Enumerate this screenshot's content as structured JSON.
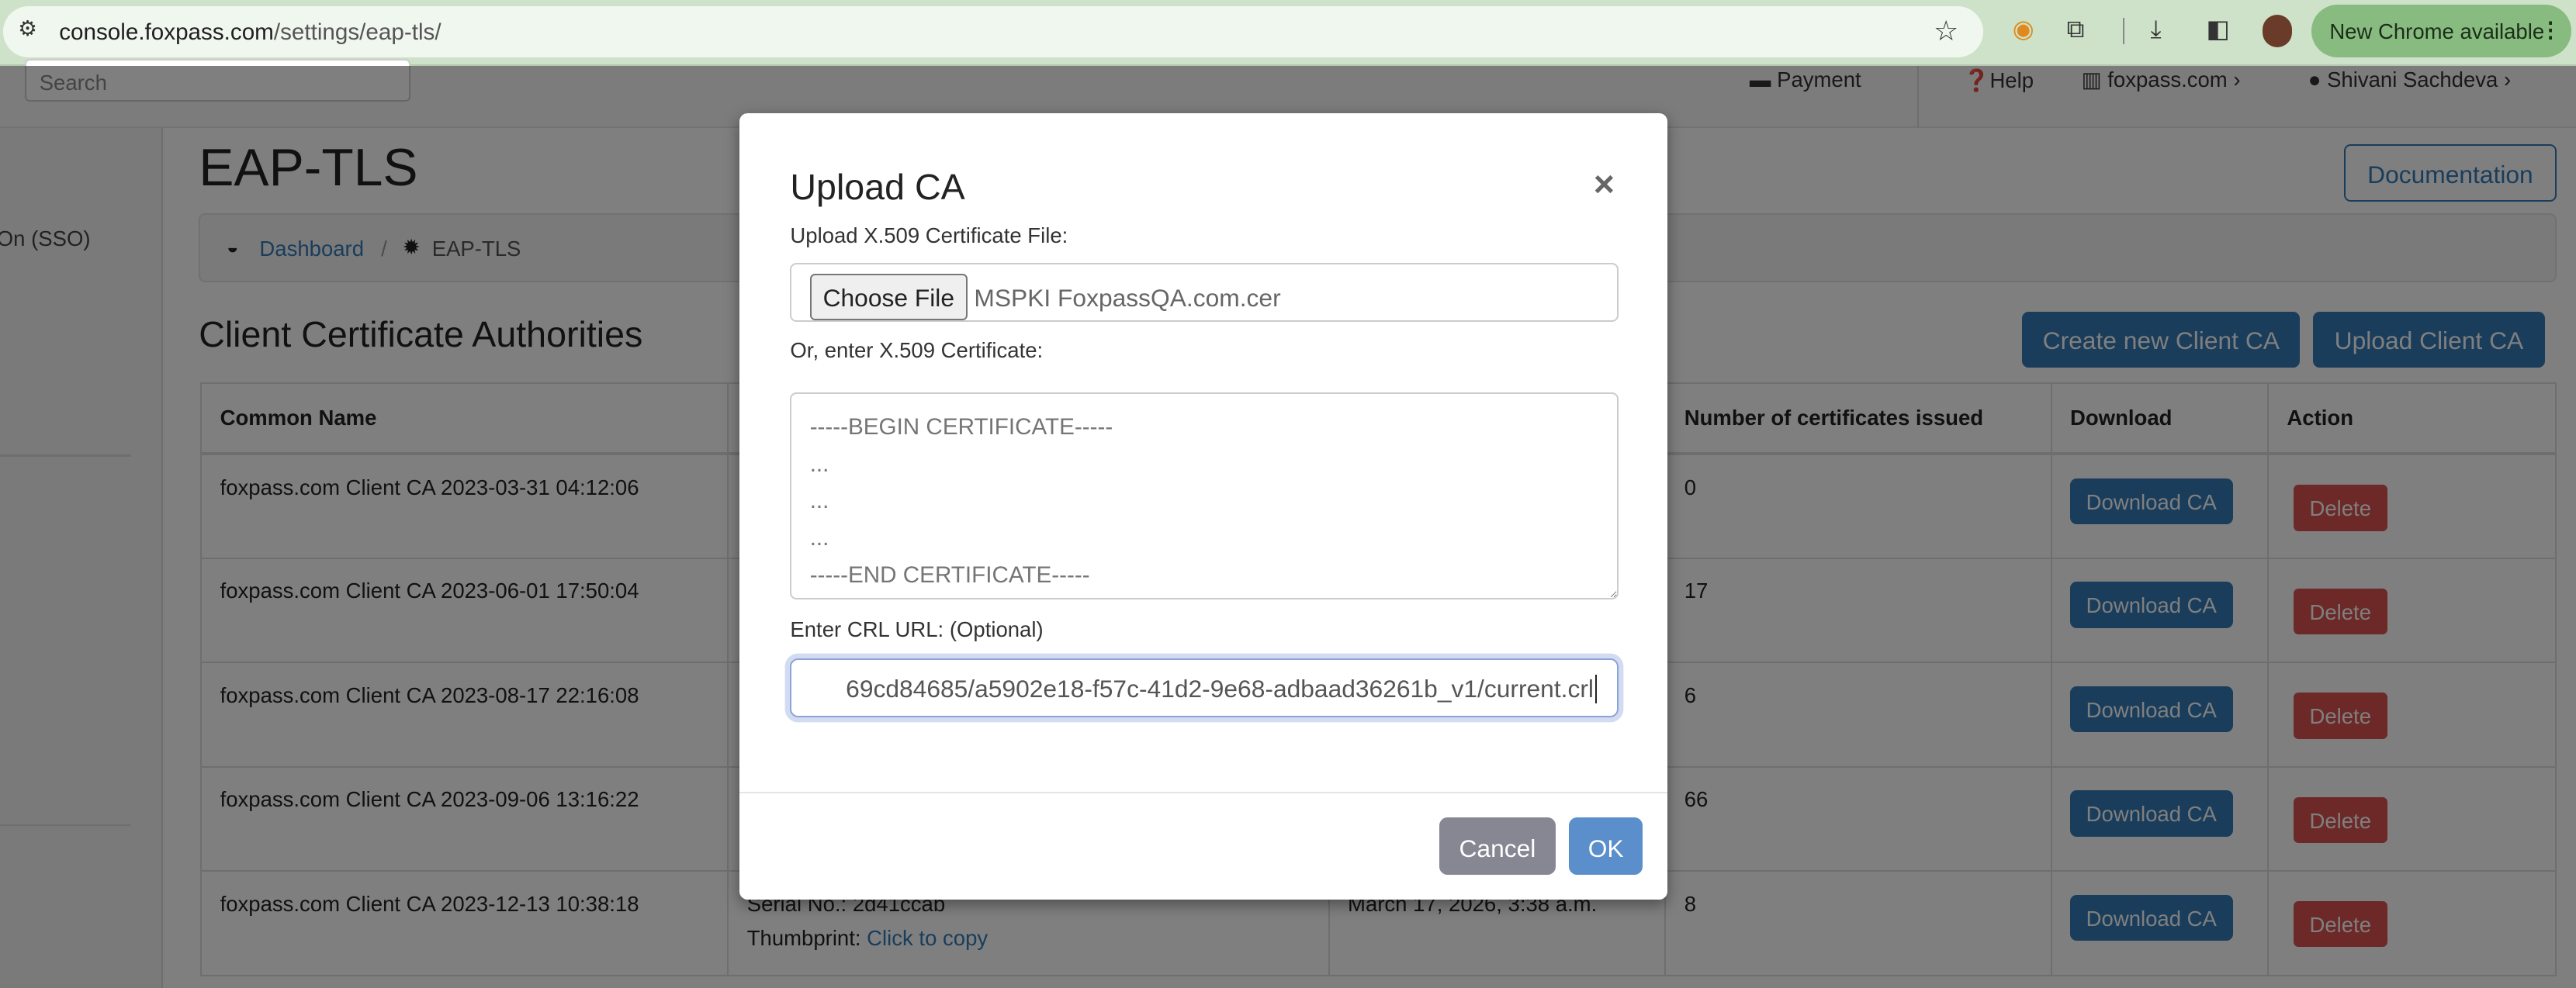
{
  "browser": {
    "url_host": "console.foxpass.com",
    "url_path": "/settings/eap-tls/",
    "new_chrome_label": "New Chrome available"
  },
  "topnav": {
    "search_placeholder": "Search",
    "payment": "Payment",
    "help": "Help",
    "org": "foxpass.com",
    "user": "Shivani Sachdeva"
  },
  "sidebar": {
    "item_partial": "On (SSO)"
  },
  "header": {
    "title": "EAP-TLS",
    "documentation": "Documentation"
  },
  "breadcrumb": {
    "dashboard": "Dashboard",
    "separator": "/",
    "current": "EAP-TLS"
  },
  "section": {
    "title": "Client Certificate Authorities",
    "create_button": "Create new Client CA",
    "upload_button": "Upload Client CA"
  },
  "table": {
    "headers": [
      "Common Name",
      "",
      "",
      "Number of certificates issued",
      "Download",
      "Action"
    ],
    "rows": [
      {
        "name": "foxpass.com Client CA 2023-03-31 04:12:06",
        "serial": "",
        "thumb_label": "",
        "thumb_link": "",
        "expires": "",
        "count": "0",
        "download": "Download CA",
        "action": "Delete"
      },
      {
        "name": "foxpass.com Client CA 2023-06-01 17:50:04",
        "serial": "",
        "thumb_label": "",
        "thumb_link": "",
        "expires": "",
        "count": "17",
        "download": "Download CA",
        "action": "Delete"
      },
      {
        "name": "foxpass.com Client CA 2023-08-17 22:16:08",
        "serial": "",
        "thumb_label": "",
        "thumb_link": "",
        "expires": "",
        "count": "6",
        "download": "Download CA",
        "action": "Delete"
      },
      {
        "name": "foxpass.com Client CA 2023-09-06 13:16:22",
        "serial": "",
        "thumb_label": "",
        "thumb_link": "",
        "expires": "",
        "count": "66",
        "download": "Download CA",
        "action": "Delete"
      },
      {
        "name": "foxpass.com Client CA 2023-12-13 10:38:18",
        "serial": "Serial No.: 2d41ccab",
        "thumb_label": "Thumbprint: ",
        "thumb_link": "Click to copy",
        "expires": "March 17, 2026, 3:38 a.m.",
        "count": "8",
        "download": "Download CA",
        "action": "Delete"
      }
    ]
  },
  "modal": {
    "title": "Upload CA",
    "close": "×",
    "file_label": "Upload X.509 Certificate File:",
    "choose_file": "Choose File",
    "file_name": "MSPKI FoxpassQA.com.cer",
    "cert_label": "Or, enter X.509 Certificate:",
    "cert_placeholder": "-----BEGIN CERTIFICATE-----\n...\n...\n...\n-----END CERTIFICATE-----",
    "crl_label": "Enter CRL URL: (Optional)",
    "crl_value": "69cd84685/a5902e18-f57c-41d2-9e68-adbaad36261b_v1/current.crl",
    "cancel": "Cancel",
    "ok": "OK"
  },
  "colors": {
    "primary": "#337ab7",
    "danger": "#d9534f",
    "chrome_bg": "#cde2c9",
    "new_chrome": "#88bb80",
    "ok": "#5b8fcb",
    "cancel": "#868793"
  }
}
